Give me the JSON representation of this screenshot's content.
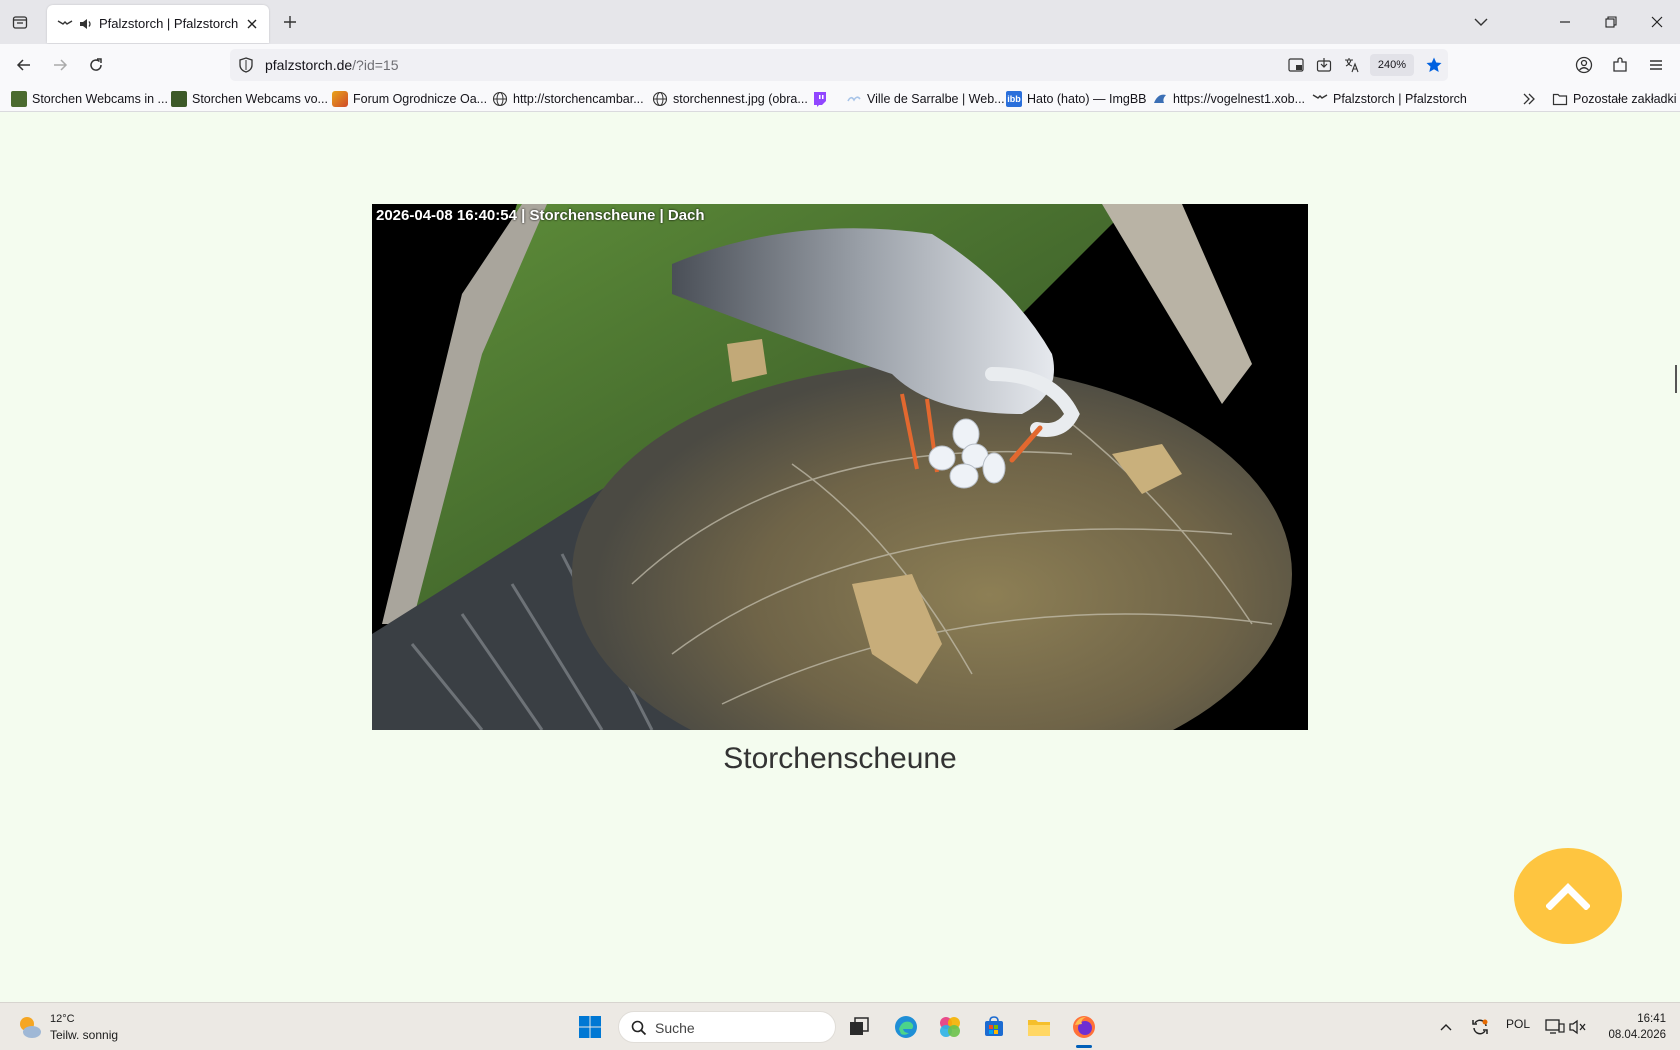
{
  "browser": {
    "tab_title": "Pfalzstorch | Pfalzstorch",
    "url_host": "pfalzstorch.de",
    "url_path": "/?id=15",
    "zoom": "240%",
    "accent": "#0061e0"
  },
  "bookmarks": [
    "Storchen Webcams in ...",
    "Storchen Webcams vo...",
    "Forum Ogrodnicze Oa...",
    "http://storchencambar...",
    "storchennest.jpg (obra...",
    "",
    "Ville de Sarralbe | Web...",
    "Hato (hato) — ImgBB",
    "https://vogelnest1.xob...",
    "Pfalzstorch | Pfalzstorch"
  ],
  "bookmarks_other": "Pozostałe zakładki",
  "page": {
    "cam_overlay": "2026-04-08  16:40:54 | Storchenscheune | Dach",
    "caption": "Storchenscheune",
    "to_top_color": "#fec540",
    "background": "#f4fcef"
  },
  "taskbar": {
    "weather_temp": "12°C",
    "weather_text": "Teilw. sonnig",
    "search_label": "Suche",
    "language": "POL",
    "time": "16:41",
    "date": "08.04.2026"
  }
}
